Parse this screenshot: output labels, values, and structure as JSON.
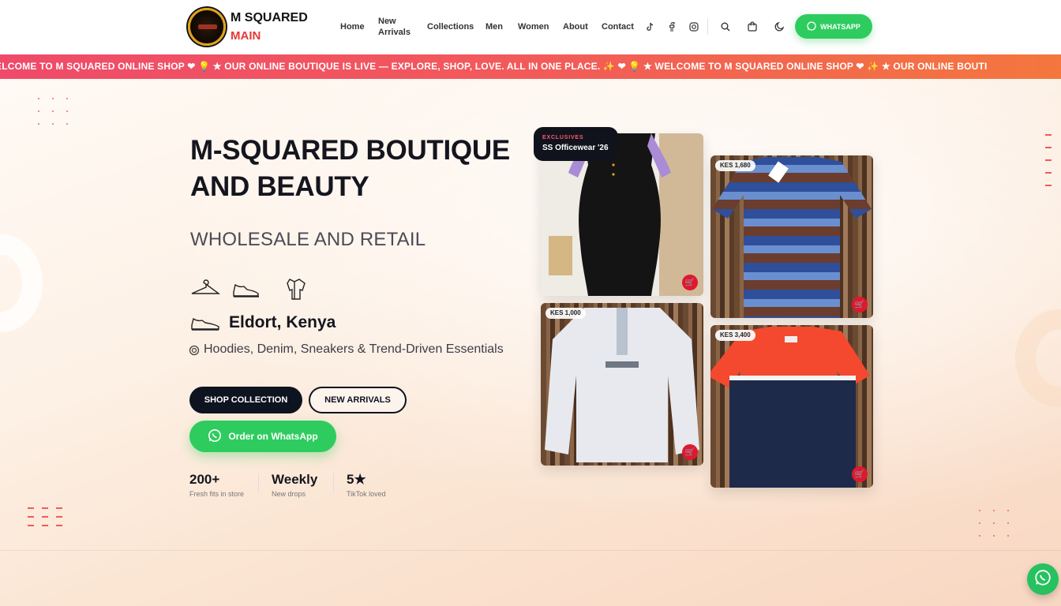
{
  "brand": {
    "line1": "M SQUARED",
    "line2": "MAIN",
    "logo_icon": "boutique-logo"
  },
  "nav": {
    "items": [
      "Home",
      "New",
      "Arrivals",
      "Collections",
      "Men",
      "Women",
      "About",
      "Contact"
    ],
    "icons": [
      "tiktok-icon",
      "facebook-icon",
      "instagram-icon",
      "search-icon",
      "bag-icon",
      "moon-icon"
    ],
    "whatsapp_label": "WHATSAPP"
  },
  "ticker": {
    "text": "ELCOME TO M SQUARED ONLINE SHOP  ❤   💡  ★  OUR ONLINE BOUTIQUE IS LIVE — EXPLORE, SHOP, LOVE. ALL IN ONE PLACE. ✨  ❤   💡  ★  WELCOME TO M SQUARED ONLINE SHOP  ❤   ✨  ★  OUR ONLINE BOUTI"
  },
  "hero": {
    "title_line1": "M-SQUARED BOUTIQUE",
    "title_line2": "AND BEAUTY",
    "subtitle": "WHOLESALE AND RETAIL",
    "location": "Eldort, Kenya",
    "tagline": "Hoodies, Denim, Sneakers & Trend-Driven Essentials",
    "shop_collection": "SHOP COLLECTION",
    "new_arrivals": "NEW ARRIVALS",
    "order_whatsapp": "Order on WhatsApp"
  },
  "stats": [
    {
      "value": "200+",
      "label": "Fresh fits in store"
    },
    {
      "value": "Weekly",
      "label": "New drops"
    },
    {
      "value": "5★",
      "label": "TikTok loved"
    }
  ],
  "products": {
    "exclusive_kicker": "EXCLUSIVES",
    "exclusive_title": "SS Officewear '26",
    "price_polo": "KES 1,680",
    "price_fleece": "KES 1,000",
    "price_tee": "KES 3,400"
  },
  "colors": {
    "accent": "#e53935",
    "whatsapp": "#2ecc5f",
    "dark": "#0e1320"
  }
}
